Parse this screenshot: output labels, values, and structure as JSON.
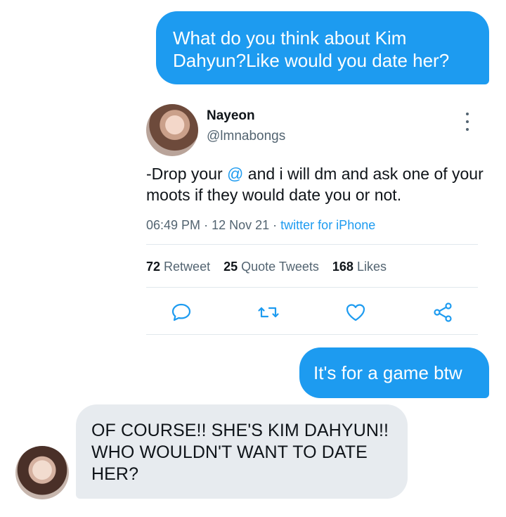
{
  "messages": {
    "outgoing_1": "What do you think about Kim Dahyun?Like would you date her?",
    "outgoing_2": "It's for a game btw",
    "incoming_1": "OF COURSE!! SHE'S KIM DAHYUN!! WHO WOULDN'T WANT TO DATE HER?"
  },
  "tweet": {
    "name": "Nayeon",
    "handle": "@lmnabongs",
    "text_before": "-Drop your ",
    "text_mention": "@",
    "text_after": " and i will dm and ask one of your moots if they would date you or not.",
    "time": "06:49 PM",
    "separator": "·",
    "date": "12 Nov 21",
    "source": "twitter for iPhone",
    "stats": {
      "retweets_count": "72",
      "retweets_label": "Retweet",
      "quotes_count": "25",
      "quotes_label": "Quote Tweets",
      "likes_count": "168",
      "likes_label": "Likes"
    },
    "actions": [
      "reply-icon",
      "retweet-icon",
      "like-icon",
      "share-icon"
    ]
  },
  "colors": {
    "accent": "#1d9bf0",
    "incoming_bubble": "#e7ebef",
    "muted_text": "#536471"
  }
}
